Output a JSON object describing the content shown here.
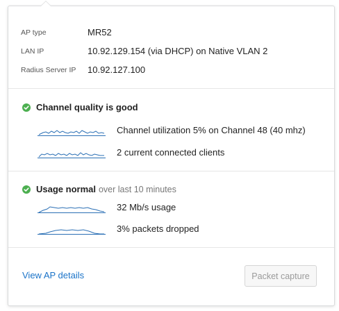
{
  "ap_info": [
    {
      "label": "AP type",
      "value": "MR52"
    },
    {
      "label": "LAN IP",
      "value": "10.92.129.154 (via DHCP) on Native VLAN 2"
    },
    {
      "label": "Radius Server IP",
      "value": "10.92.127.100"
    }
  ],
  "channel_section": {
    "title": "Channel quality is good",
    "metrics": [
      {
        "text": "Channel utilization 5% on Channel 48 (40 mhz)"
      },
      {
        "text": "2 current connected clients"
      }
    ]
  },
  "usage_section": {
    "title": "Usage normal",
    "subtitle": "over last 10 minutes",
    "metrics": [
      {
        "text": "32 Mb/s usage"
      },
      {
        "text": "3% packets dropped"
      }
    ]
  },
  "footer": {
    "link_label": "View AP details",
    "button_label": "Packet capture"
  },
  "colors": {
    "link": "#1a73c8",
    "status_ok": "#4caf50",
    "sparkline": "#2a6fb5"
  }
}
